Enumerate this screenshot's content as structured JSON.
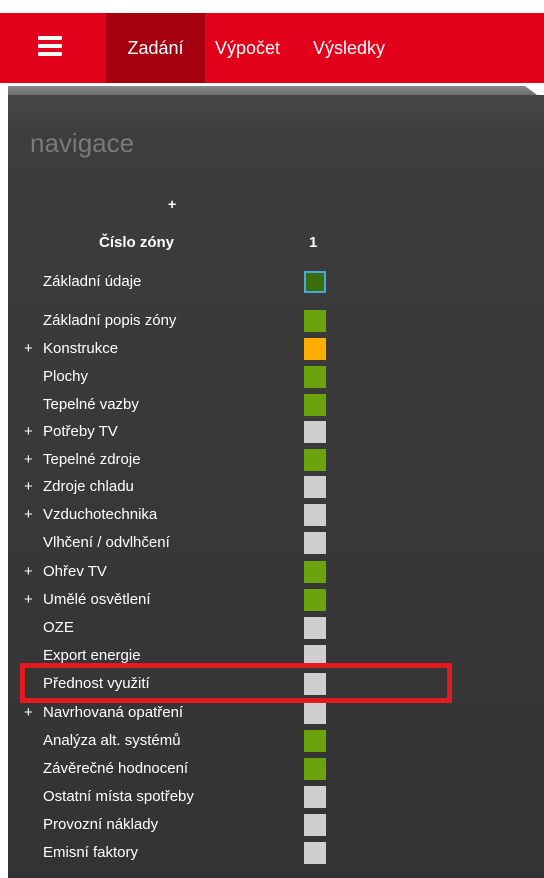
{
  "header": {
    "menu_icon": "hamburger-menu-icon",
    "tabs": [
      {
        "label": "Zadání",
        "active": true
      },
      {
        "label": "Výpočet",
        "active": false
      },
      {
        "label": "Výsledky",
        "active": false
      }
    ],
    "color": "#e2001a",
    "active_color": "#a4000f"
  },
  "panel": {
    "title": "navigace",
    "plus": "+",
    "zone_label": "Číslo zóny",
    "zone_number": "1"
  },
  "rows": [
    {
      "label": "Základní údaje",
      "plus": "",
      "status": "selected"
    },
    {
      "label": "Základní popis zóny",
      "plus": "",
      "status": "green"
    },
    {
      "label": "Konstrukce",
      "plus": "+",
      "status": "orange"
    },
    {
      "label": "Plochy",
      "plus": "",
      "status": "green"
    },
    {
      "label": "Tepelné vazby",
      "plus": "",
      "status": "green"
    },
    {
      "label": "Potřeby TV",
      "plus": "+",
      "status": "grey"
    },
    {
      "label": "Tepelné zdroje",
      "plus": "+",
      "status": "green"
    },
    {
      "label": "Zdroje chladu",
      "plus": "+",
      "status": "grey"
    },
    {
      "label": "Vzduchotechnika",
      "plus": "+",
      "status": "grey"
    },
    {
      "label": "Vlhčení / odvlhčení",
      "plus": "",
      "status": "grey"
    },
    {
      "label": "Ohřev TV",
      "plus": "+",
      "status": "green"
    },
    {
      "label": "Umělé osvětlení",
      "plus": "+",
      "status": "green"
    },
    {
      "label": "OZE",
      "plus": "",
      "status": "grey"
    },
    {
      "label": "Export energie",
      "plus": "",
      "status": "grey"
    },
    {
      "label": "Přednost využití",
      "plus": "",
      "status": "grey"
    },
    {
      "label": "Navrhovaná opatření",
      "plus": "+",
      "status": "grey"
    },
    {
      "label": "Analýza alt. systémů",
      "plus": "",
      "status": "green"
    },
    {
      "label": "Závěrečné hodnocení",
      "plus": "",
      "status": "green"
    },
    {
      "label": "Ostatní místa spotřeby",
      "plus": "",
      "status": "grey"
    },
    {
      "label": "Provozní náklady",
      "plus": "",
      "status": "grey"
    },
    {
      "label": "Emisní faktory",
      "plus": "",
      "status": "grey"
    }
  ],
  "colors": {
    "green": "#6aa30c",
    "orange": "#ffae00",
    "grey": "#cfcfcf",
    "selected_fill": "#3b6e0a",
    "selected_outline": "#45a9e6",
    "highlight": "#e2191f"
  }
}
